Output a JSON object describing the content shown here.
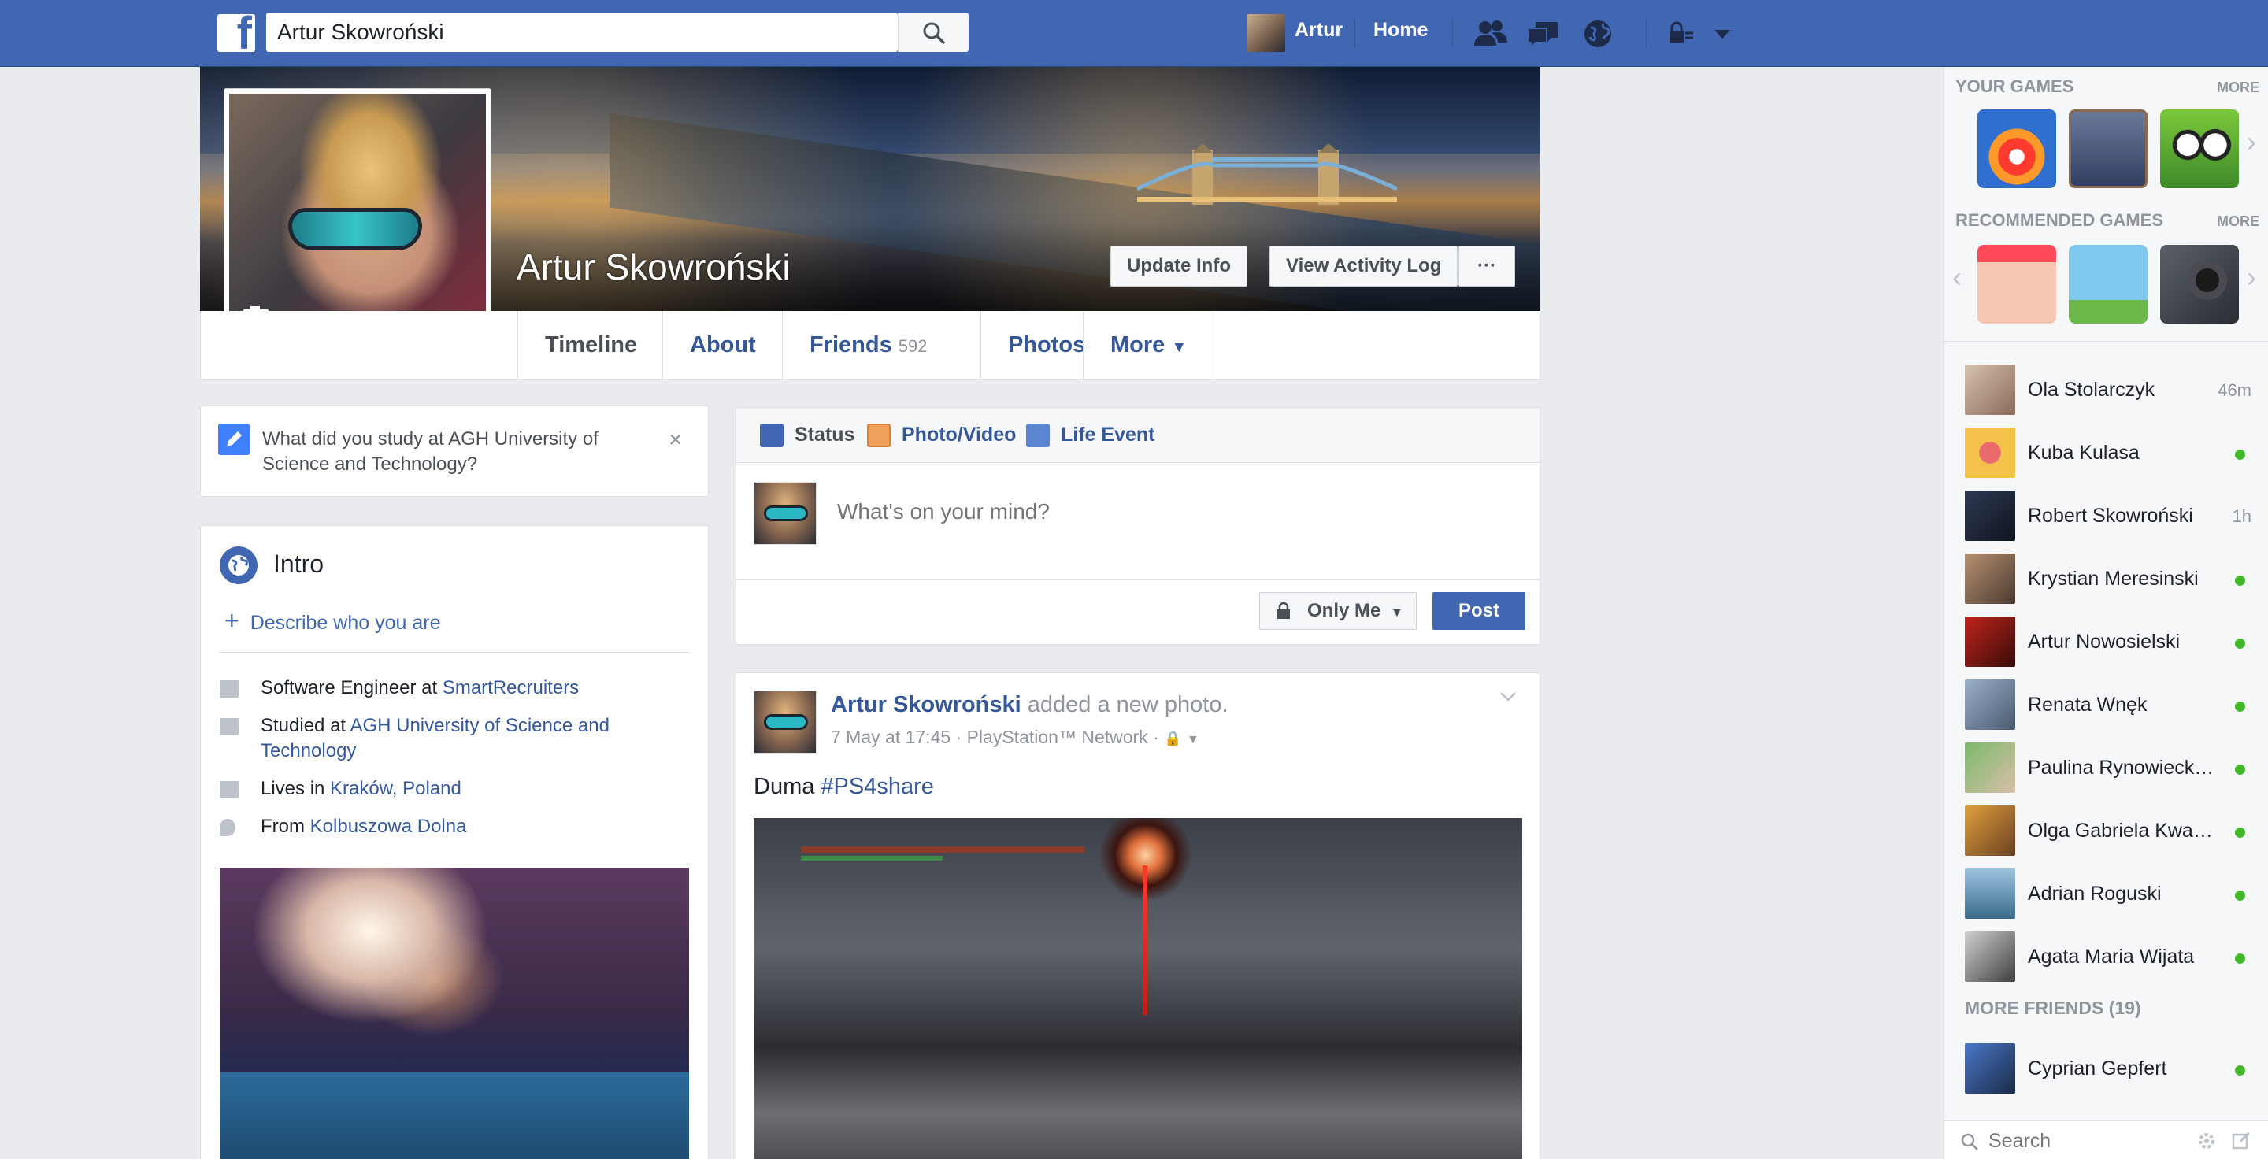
{
  "topbar": {
    "search_value": "Artur Skowroński",
    "user_name": "Artur",
    "home": "Home"
  },
  "profile": {
    "name": "Artur Skowroński",
    "update_info": "Update Info",
    "view_activity_log": "View Activity Log",
    "more_dots": "···"
  },
  "tabs": {
    "timeline": "Timeline",
    "about": "About",
    "friends": "Friends",
    "friends_count": "592",
    "photos": "Photos",
    "more": "More"
  },
  "study_prompt": {
    "text": "What did you study at AGH University of Science and Technology?",
    "close": "×"
  },
  "intro": {
    "title": "Intro",
    "describe": "Describe who you are",
    "work_prefix": "Software Engineer at ",
    "work_link": "SmartRecruiters",
    "study_prefix": "Studied at ",
    "study_link": "AGH University of Science and Technology",
    "lives_prefix": "Lives in ",
    "lives_link": "Kraków, Poland",
    "from_prefix": "From ",
    "from_link": "Kolbuszowa Dolna"
  },
  "composer": {
    "status": "Status",
    "photo_video": "Photo/Video",
    "life_event": "Life Event",
    "placeholder": "What's on your mind?",
    "privacy": "Only Me",
    "post": "Post"
  },
  "post": {
    "author": "Artur Skowroński",
    "action": " added a new photo.",
    "meta": "7 May at 17:45 · PlayStation™ Network ·",
    "text_plain": "Duma ",
    "hashtag": "#PS4share"
  },
  "sidebar": {
    "your_games": "YOUR GAMES",
    "recommended_games": "RECOMMENDED GAMES",
    "more": "MORE",
    "more_friends": "MORE FRIENDS (19)",
    "search_placeholder": "Search",
    "friends": [
      {
        "name": "Ola Stolarczyk",
        "status": "46m"
      },
      {
        "name": "Kuba Kulasa",
        "status": ""
      },
      {
        "name": "Robert Skowroński",
        "status": "1h"
      },
      {
        "name": "Krystian Meresinski",
        "status": ""
      },
      {
        "name": "Artur Nowosielski",
        "status": ""
      },
      {
        "name": "Renata Wnęk",
        "status": ""
      },
      {
        "name": "Paulina Rynowiecka...",
        "status": ""
      },
      {
        "name": "Olga Gabriela Kwaśny",
        "status": ""
      },
      {
        "name": "Adrian Roguski",
        "status": ""
      },
      {
        "name": "Agata Maria Wijata",
        "status": ""
      }
    ],
    "extra_friend": "Cyprian Gepfert"
  }
}
